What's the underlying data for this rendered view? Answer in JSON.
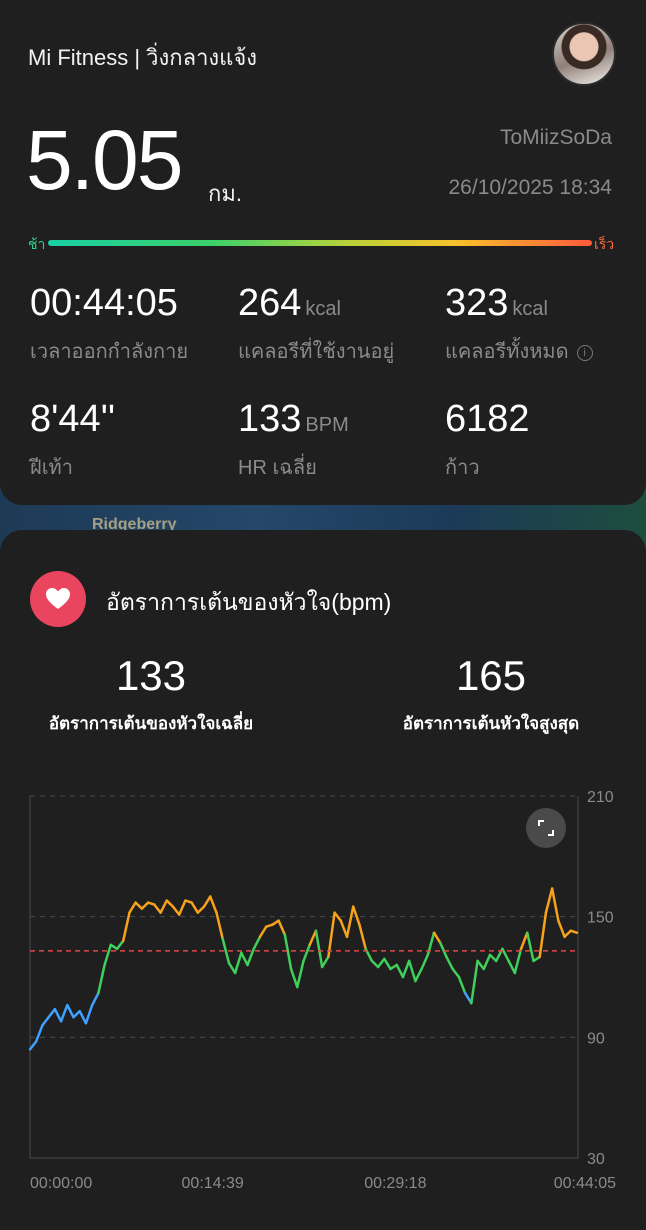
{
  "header": {
    "app_title": "Mi Fitness | วิ่งกลางแจ้ง",
    "avatar": "user-avatar"
  },
  "summary": {
    "distance_value": "5.05",
    "distance_unit": "กม.",
    "username": "ToMiizSoDa",
    "datetime": "26/10/2025 18:34",
    "pace_slow_label": "ช้า",
    "pace_fast_label": "เร็ว"
  },
  "stats": [
    {
      "value": "00:44:05",
      "unit": "",
      "label": "เวลาออกกำลังกาย"
    },
    {
      "value": "264",
      "unit": "kcal",
      "label": "แคลอรีที่ใช้งานอยู่"
    },
    {
      "value": "323",
      "unit": "kcal",
      "label": "แคลอรีทั้งหมด",
      "info_icon": "i"
    },
    {
      "value": "8'44''",
      "unit": "",
      "label": "ฝีเท้า"
    },
    {
      "value": "133",
      "unit": "BPM",
      "label": "HR เฉลี่ย"
    },
    {
      "value": "6182",
      "unit": "",
      "label": "ก้าว"
    }
  ],
  "map_peek": {
    "label": "Ridgeberry"
  },
  "heart_rate": {
    "title": "อัตราการเต้นของหัวใจ(bpm)",
    "avg_value": "133",
    "avg_label": "อัตราการเต้นของหัวใจเฉลี่ย",
    "max_value": "165",
    "max_label": "อัตราการเต้นหัวใจสูงสุด"
  },
  "colors": {
    "heart_badge": "#e9455f",
    "zone_blue": "#3fa0ff",
    "zone_green": "#3fcf5a",
    "zone_orange": "#f7a21b",
    "avg_line": "#e0484a"
  },
  "chart_data": {
    "type": "line",
    "title": "",
    "ylim": [
      30,
      210
    ],
    "y_ticks": [
      210,
      150,
      90,
      30
    ],
    "x_tick_labels": [
      "00:00:00",
      "00:14:39",
      "00:29:18",
      "00:44:05"
    ],
    "x_minutes_range": [
      0,
      44.08
    ],
    "average_reference_bpm": 133,
    "series": [
      {
        "x_minutes": [
          0,
          0.5,
          1,
          1.5,
          2,
          2.5,
          3,
          3.5,
          4,
          4.5,
          5,
          5.5,
          6,
          6.5,
          7,
          7.5,
          8,
          8.5,
          9,
          9.5,
          10,
          10.5,
          11,
          11.5,
          12,
          12.5,
          13,
          13.5,
          14,
          14.5,
          15,
          15.5,
          16,
          16.5,
          17,
          17.5,
          18,
          18.5,
          19,
          19.5,
          20,
          20.5,
          21,
          21.5,
          22,
          22.5,
          23,
          23.5,
          24,
          24.5,
          25,
          25.5,
          26,
          26.5,
          27,
          27.5,
          28,
          28.5,
          29,
          29.5,
          30,
          30.5,
          31,
          31.5,
          32,
          32.5,
          33,
          33.5,
          34,
          34.5,
          35,
          35.5,
          36,
          36.5,
          37,
          37.5,
          38,
          38.5,
          39,
          39.5,
          40,
          40.5,
          41,
          41.5,
          42,
          42.5,
          43,
          43.5,
          44
        ],
        "bpm": [
          84,
          88,
          96,
          100,
          104,
          98,
          106,
          100,
          103,
          97,
          106,
          112,
          126,
          136,
          134,
          138,
          152,
          157,
          154,
          157,
          156,
          152,
          158,
          155,
          151,
          158,
          157,
          152,
          155,
          160,
          152,
          139,
          127,
          122,
          132,
          126,
          134,
          140,
          145,
          146,
          148,
          141,
          124,
          115,
          128,
          136,
          143,
          125,
          130,
          152,
          148,
          140,
          155,
          146,
          134,
          128,
          125,
          129,
          124,
          126,
          120,
          128,
          118,
          124,
          131,
          142,
          137,
          130,
          124,
          120,
          112,
          107,
          128,
          124,
          131,
          128,
          134,
          128,
          122,
          134,
          142,
          128,
          130,
          152,
          164,
          148,
          140,
          143,
          142
        ]
      }
    ]
  }
}
